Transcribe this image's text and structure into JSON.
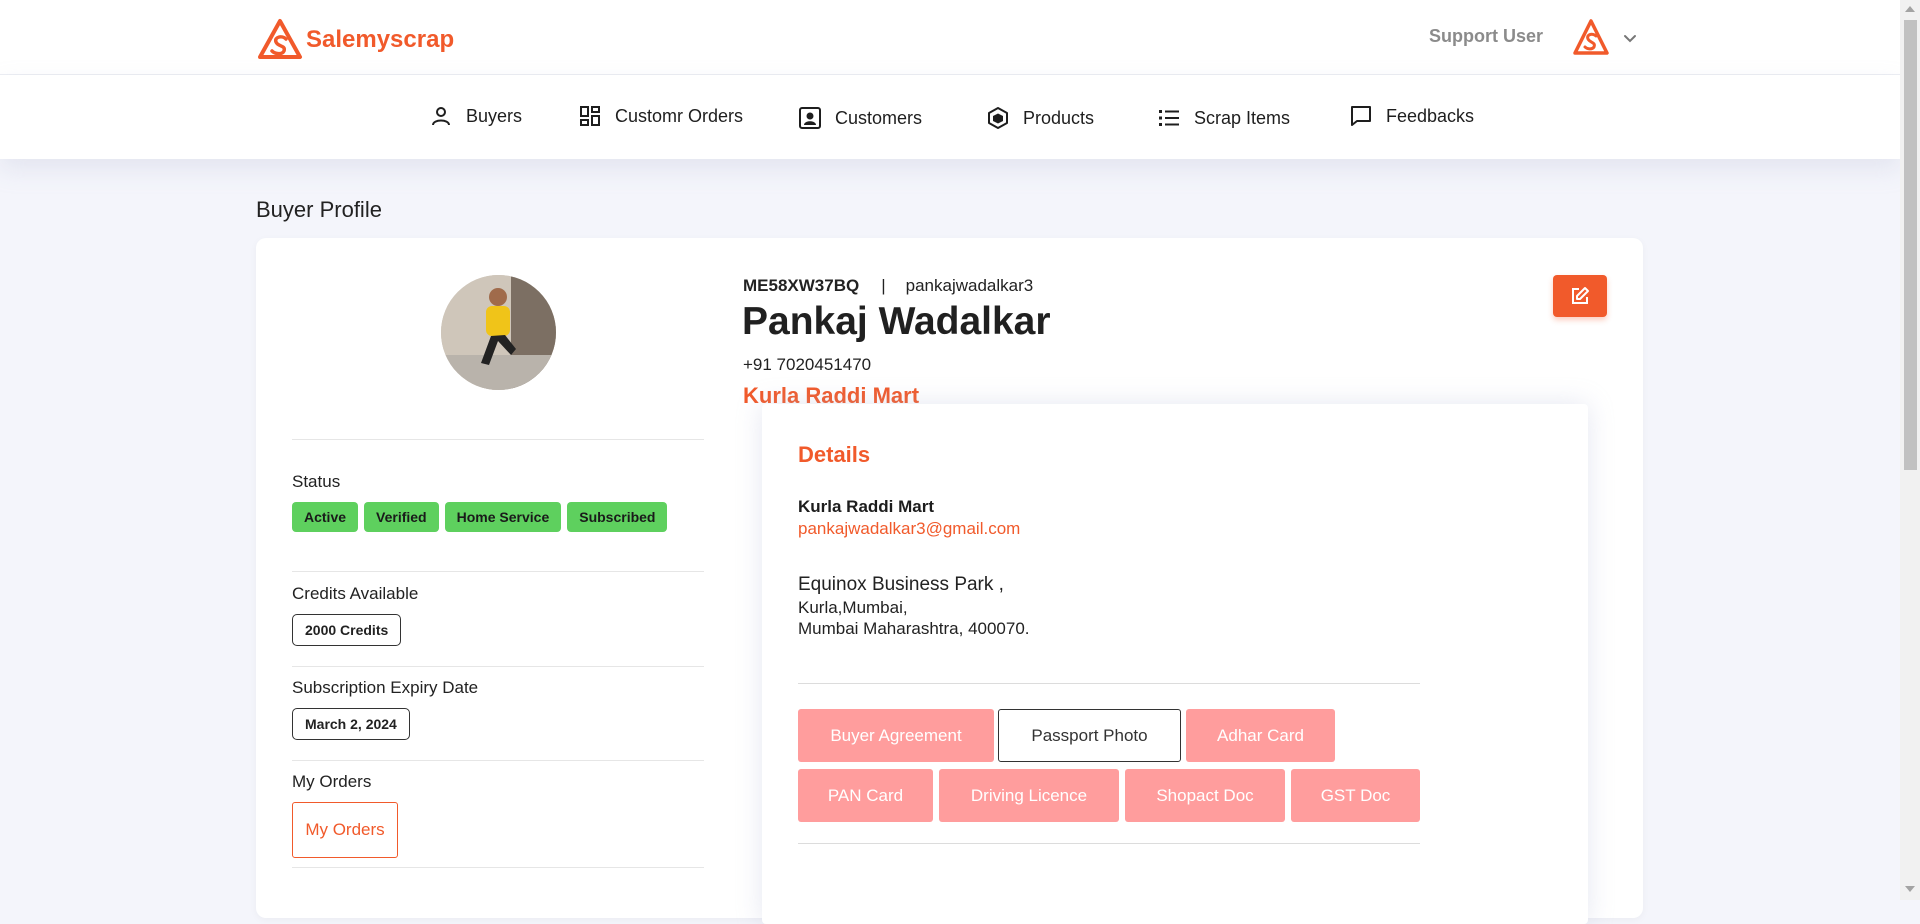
{
  "header": {
    "brand": "Salemyscrap",
    "user_label": "Support User"
  },
  "nav": {
    "items": [
      {
        "label": "Buyers",
        "icon": "user-icon"
      },
      {
        "label": "Customr Orders",
        "icon": "dashboard-icon"
      },
      {
        "label": "Customers",
        "icon": "contact-card-icon"
      },
      {
        "label": "Products",
        "icon": "cube-icon"
      },
      {
        "label": "Scrap Items",
        "icon": "list-icon"
      },
      {
        "label": "Feedbacks",
        "icon": "chat-icon"
      }
    ]
  },
  "page": {
    "title": "Buyer Profile"
  },
  "profile": {
    "code": "ME58XW37BQ",
    "separator": "|",
    "username": "pankajwadalkar3",
    "name": "Pankaj Wadalkar",
    "phone": "+91 7020451470",
    "shop": "Kurla Raddi Mart",
    "status_label": "Status",
    "badges": [
      "Active",
      "Verified",
      "Home Service",
      "Subscribed"
    ],
    "credits_label": "Credits Available",
    "credits_value": "2000 Credits",
    "expiry_label": "Subscription Expiry Date",
    "expiry_value": "March 2, 2024",
    "orders_label": "My Orders",
    "orders_button": "My Orders"
  },
  "details": {
    "title": "Details",
    "shop": "Kurla Raddi Mart",
    "email": "pankajwadalkar3@gmail.com",
    "address_line1": "Equinox Business Park ,",
    "address_line2": "Kurla,Mumbai,",
    "address_line3": "Mumbai Maharashtra, 400070.",
    "documents": [
      "Buyer Agreement",
      "Passport Photo",
      "Adhar Card",
      "PAN Card",
      "Driving Licence",
      "Shopact Doc",
      "GST Doc"
    ]
  },
  "colors": {
    "accent": "#f15a2b",
    "badge_green": "#5ed05e",
    "doc_disabled": "#ff9d9d"
  }
}
